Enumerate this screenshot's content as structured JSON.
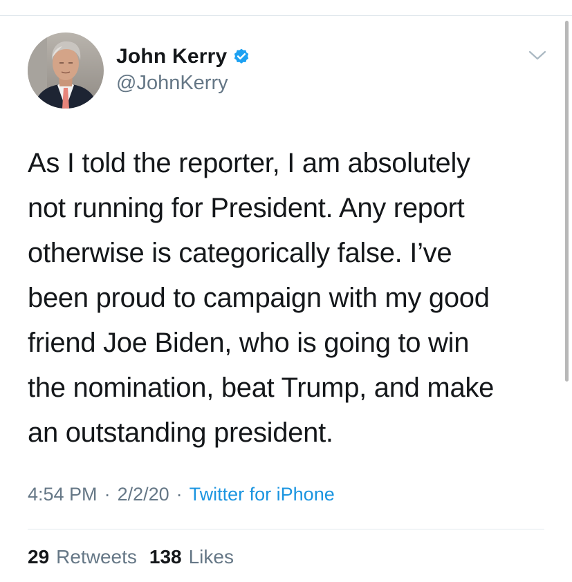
{
  "tweet": {
    "author": {
      "display_name": "John Kerry",
      "handle": "@JohnKerry",
      "verified": true,
      "avatar": "profile-photo"
    },
    "text": "As I told the reporter, I am absolutely\nnot running for President. Any report\notherwise is categorically false. I’ve\nbeen proud to campaign with my good\nfriend Joe Biden, who is going to win\nthe nomination, beat Trump, and make\nan outstanding president.",
    "meta": {
      "time": "4:54 PM",
      "separator": "·",
      "date": "2/2/20",
      "source": "Twitter for iPhone"
    },
    "stats": {
      "retweets_count": "29",
      "retweets_label": "Retweets",
      "likes_count": "138",
      "likes_label": "Likes"
    }
  },
  "icons": {
    "verified": "verified-badge-icon",
    "menu": "chevron-down-icon"
  },
  "colors": {
    "text_primary": "#14171a",
    "text_secondary": "#657786",
    "link": "#1b95e0",
    "verified": "#1da1f2",
    "divider": "#e1e8ed"
  }
}
